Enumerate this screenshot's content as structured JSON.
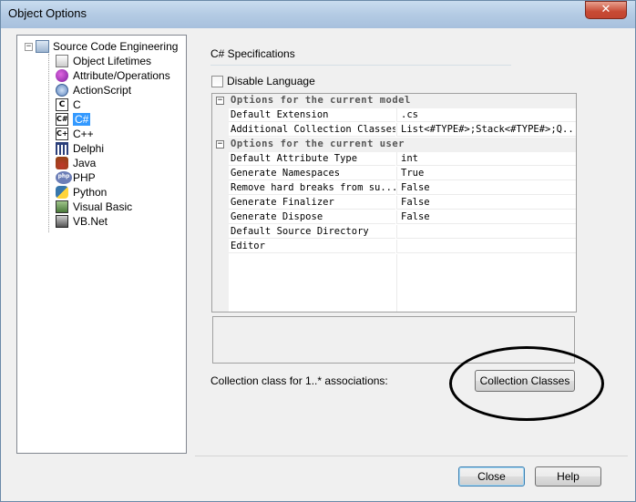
{
  "window": {
    "title": "Object Options",
    "close_symbol": "✕"
  },
  "tree": {
    "root": {
      "label": "Source Code Engineering",
      "expander": "−"
    },
    "items": [
      {
        "label": "Object Lifetimes",
        "icon": "lifetimes-icon",
        "glyph": ""
      },
      {
        "label": "Attribute/Operations",
        "icon": "attribute-operations-icon",
        "glyph": ""
      },
      {
        "label": "ActionScript",
        "icon": "actionscript-icon",
        "glyph": ""
      },
      {
        "label": "C",
        "icon": "c-language-icon",
        "glyph": "C"
      },
      {
        "label": "C#",
        "icon": "csharp-icon",
        "glyph": "C#",
        "selected": true
      },
      {
        "label": "C++",
        "icon": "cpp-icon",
        "glyph": "C+"
      },
      {
        "label": "Delphi",
        "icon": "delphi-icon",
        "glyph": ""
      },
      {
        "label": "Java",
        "icon": "java-icon",
        "glyph": ""
      },
      {
        "label": "PHP",
        "icon": "php-icon",
        "glyph": "php"
      },
      {
        "label": "Python",
        "icon": "python-icon",
        "glyph": ""
      },
      {
        "label": "Visual Basic",
        "icon": "visual-basic-icon",
        "glyph": ""
      },
      {
        "label": "VB.Net",
        "icon": "vbnet-icon",
        "glyph": ""
      }
    ]
  },
  "panel": {
    "title": "C# Specifications",
    "disable_language_label": "Disable Language",
    "disable_language_checked": false
  },
  "grid": {
    "categories": [
      {
        "label": "Options for the current model",
        "expander": "−"
      },
      {
        "label": "Options for the current user",
        "expander": "−"
      }
    ],
    "model_rows": [
      {
        "key": "Default Extension",
        "value": ".cs"
      },
      {
        "key": "Additional Collection Classes",
        "value": "List<#TYPE#>;Stack<#TYPE#>;Q..."
      }
    ],
    "user_rows": [
      {
        "key": "Default Attribute Type",
        "value": "int"
      },
      {
        "key": "Generate Namespaces",
        "value": "True"
      },
      {
        "key": "Remove hard breaks from su...",
        "value": "False"
      },
      {
        "key": "Generate Finalizer",
        "value": "False"
      },
      {
        "key": "Generate Dispose",
        "value": "False"
      },
      {
        "key": "Default Source Directory",
        "value": ""
      },
      {
        "key": "Editor",
        "value": ""
      }
    ]
  },
  "collection": {
    "label": "Collection class for 1..* associations:",
    "button": "Collection Classes"
  },
  "buttons": {
    "close": "Close",
    "help": "Help"
  },
  "colors": {
    "selection": "#3399ff",
    "annotation_ellipse": "#000000"
  }
}
